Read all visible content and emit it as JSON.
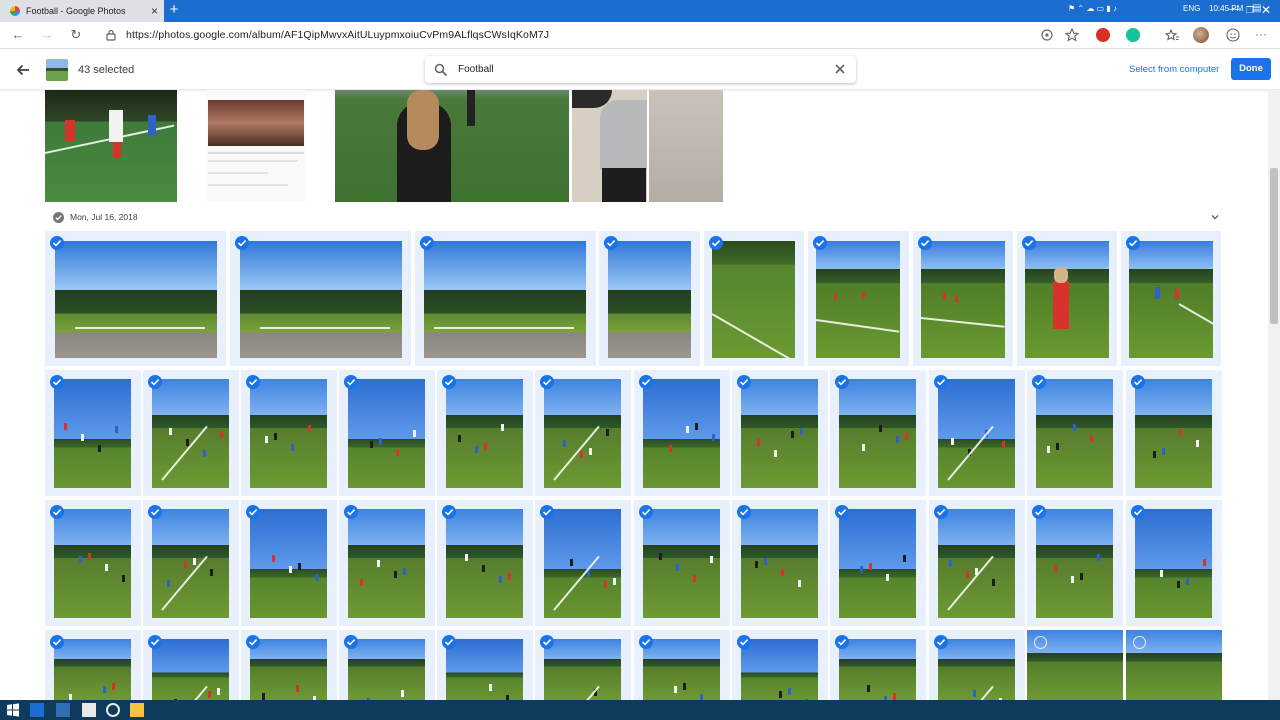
{
  "browser": {
    "tab_title": "Football - Google Photos",
    "url": "https://photos.google.com/album/AF1QipMwvxAitULuypmxoiuCvPm9ALflqsCWsIqKoM7J",
    "new_tab": "+",
    "tab_close": "×"
  },
  "header": {
    "selected_count": "43 selected",
    "search_value": "Football",
    "select_from_computer": "Select from computer",
    "done": "Done"
  },
  "section": {
    "date": "Mon, Jul 16, 2018"
  },
  "colors": {
    "accent": "#1a73e8",
    "selected_bg": "#e8f0fe",
    "titlebar": "#1c6dd0",
    "taskbar": "#0e3a5c"
  },
  "taskbar": {
    "language": "ENG",
    "time": "10:45 PM"
  }
}
